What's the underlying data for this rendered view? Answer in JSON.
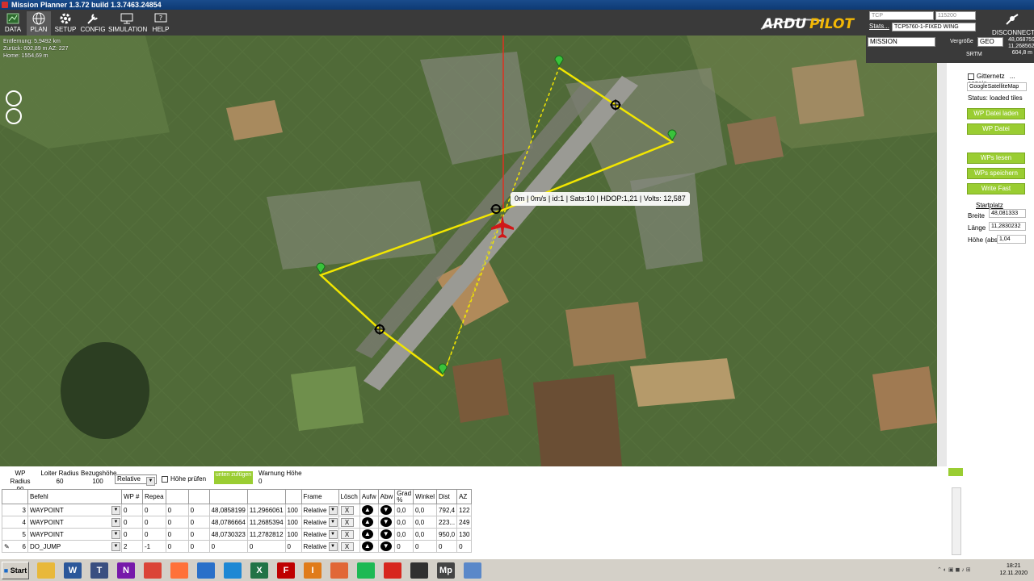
{
  "window": {
    "title": "Mission Planner 1.3.72 build 1.3.7463.24854"
  },
  "toolbar": {
    "items": [
      {
        "label": "DATA",
        "icon": "data-icon"
      },
      {
        "label": "PLAN",
        "icon": "globe-icon"
      },
      {
        "label": "SETUP",
        "icon": "gear-icon"
      },
      {
        "label": "CONFIG",
        "icon": "wrench-icon"
      },
      {
        "label": "SIMULATION",
        "icon": "monitor-icon"
      },
      {
        "label": "HELP",
        "icon": "help-icon"
      }
    ],
    "logo_text": "ARDUPILOT",
    "conn_type": "TCP",
    "baud": "115200",
    "stats_label": "Stats...",
    "vehicle": "TCP5760-1-FIXED WING",
    "disconnect_label": "DISCONNECT"
  },
  "map_info": {
    "distance": "Entfernung: 5,9492 km",
    "back": "Zurück: 602,89 m AZ: 227",
    "home": "Home: 1554,69 m"
  },
  "status_overlay": "0m | 0m/s | id:1 | Sats:10 | HDOP:1,21 | Volts: 12,587",
  "waypoint_labels": [
    "3",
    "4",
    "5",
    "6"
  ],
  "right_panel": {
    "mode_select": "MISSION",
    "zoom_label": "Vergröße",
    "coord_format": "GEO",
    "lat": "48,0687595",
    "lon": "11,2685623",
    "alt": "604,8 m",
    "srtm_label": "SRTM",
    "grid_label": "Gitternetz",
    "show_label": "... anzeig",
    "map_type": "GoogleSatelliteMap",
    "status": "Status: loaded tiles",
    "buttons": [
      "WP Datei laden",
      "WP Datei speichern",
      "WPs lesen",
      "WPs speichern",
      "Write Fast"
    ],
    "startplatz": {
      "title": "Startplatz",
      "breite_label": "Breite",
      "breite": "48,081333",
      "laenge_label": "Länge",
      "laenge": "11,2830232",
      "hoehe_label": "Höhe (abs)",
      "hoehe": "1,04"
    }
  },
  "bottom_params": {
    "wp_radius_label": "WP Radius",
    "wp_radius": "90",
    "loiter_radius_label": "Loiter Radius",
    "loiter_radius": "60",
    "bezugshoehe_label": "Bezugshöhe",
    "bezugshoehe": "100",
    "frame_select": "Relative",
    "hoehe_pruefen": "Höhe prüfen",
    "unten_button": "unten zufügen",
    "warnung_label": "Warnung Höhe",
    "warnung": "0"
  },
  "table": {
    "headers": [
      "",
      "Befehl",
      "WP #",
      "Repea",
      "",
      "",
      "",
      "",
      "",
      "Frame",
      "Lösch",
      "Aufw",
      "Abw",
      "Grad %",
      "Winkel",
      "Dist",
      "AZ"
    ],
    "rows": [
      [
        "3",
        "WAYPOINT",
        "0",
        "0",
        "0",
        "0",
        "48,0858199",
        "11,2966061",
        "100",
        "Relative",
        "X",
        "▲",
        "▼",
        "0,0",
        "0,0",
        "792,4",
        "122"
      ],
      [
        "4",
        "WAYPOINT",
        "0",
        "0",
        "0",
        "0",
        "48,0786664",
        "11,2685394",
        "100",
        "Relative",
        "X",
        "▲",
        "▼",
        "0,0",
        "0,0",
        "223...",
        "249"
      ],
      [
        "5",
        "WAYPOINT",
        "0",
        "0",
        "0",
        "0",
        "48,0730323",
        "11,2782812",
        "100",
        "Relative",
        "X",
        "▲",
        "▼",
        "0,0",
        "0,0",
        "950,0",
        "130"
      ],
      [
        "6",
        "DO_JUMP",
        "2",
        "-1",
        "0",
        "0",
        "0",
        "0",
        "0",
        "Relative",
        "X",
        "▲",
        "▼",
        "0",
        "0",
        "0",
        "0"
      ]
    ]
  },
  "taskbar": {
    "start_label": "Start",
    "apps": [
      {
        "name": "explorer",
        "glyph": "",
        "color": "#e8b83a"
      },
      {
        "name": "word",
        "glyph": "W",
        "color": "#2b579a"
      },
      {
        "name": "texstudio",
        "glyph": "T",
        "color": "#3a4f80"
      },
      {
        "name": "onenote",
        "glyph": "N",
        "color": "#7719aa"
      },
      {
        "name": "chrome",
        "glyph": "",
        "color": "#db4437"
      },
      {
        "name": "firefox",
        "glyph": "",
        "color": "#ff7139"
      },
      {
        "name": "thunderbird",
        "glyph": "",
        "color": "#2a70c9"
      },
      {
        "name": "vscode",
        "glyph": "",
        "color": "#1e88d4"
      },
      {
        "name": "excel",
        "glyph": "X",
        "color": "#217346"
      },
      {
        "name": "filezilla",
        "glyph": "F",
        "color": "#bf0000"
      },
      {
        "name": "app-i",
        "glyph": "I",
        "color": "#e07b1a"
      },
      {
        "name": "matlab",
        "glyph": "",
        "color": "#e16737"
      },
      {
        "name": "spotify",
        "glyph": "",
        "color": "#1db954"
      },
      {
        "name": "acrobat",
        "glyph": "",
        "color": "#d7261e"
      },
      {
        "name": "obs",
        "glyph": "",
        "color": "#303030"
      },
      {
        "name": "missionplanner",
        "glyph": "Mp",
        "color": "#444"
      },
      {
        "name": "window",
        "glyph": "",
        "color": "#5a88c9"
      }
    ],
    "time": "18:21",
    "date": "12.11.2020"
  }
}
